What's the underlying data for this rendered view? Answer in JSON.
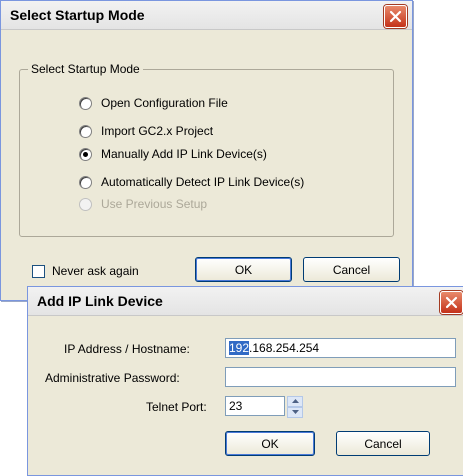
{
  "startup_dialog": {
    "title": "Select Startup Mode",
    "group_label": "Select Startup Mode",
    "options": [
      {
        "label": "Open Configuration File",
        "checked": false,
        "disabled": false
      },
      {
        "label": "Import GC2.x Project",
        "checked": false,
        "disabled": false
      },
      {
        "label": "Manually Add IP Link Device(s)",
        "checked": true,
        "disabled": false
      },
      {
        "label": "Automatically Detect IP Link Device(s)",
        "checked": false,
        "disabled": false
      },
      {
        "label": "Use Previous Setup",
        "checked": false,
        "disabled": true
      }
    ],
    "never_ask_label": "Never ask again",
    "never_ask_checked": false,
    "ok_label": "OK",
    "cancel_label": "Cancel"
  },
  "add_device_dialog": {
    "title": "Add IP Link Device",
    "ip_label": "IP Address / Hostname:",
    "ip_selected": "192",
    "ip_rest": ".168.254.254",
    "password_label": "Administrative Password:",
    "password_value": "",
    "telnet_label": "Telnet Port:",
    "telnet_value": "23",
    "ok_label": "OK",
    "cancel_label": "Cancel"
  },
  "icons": {
    "close": "close-x-icon",
    "spin_up": "spin-up-icon",
    "spin_down": "spin-down-icon"
  }
}
